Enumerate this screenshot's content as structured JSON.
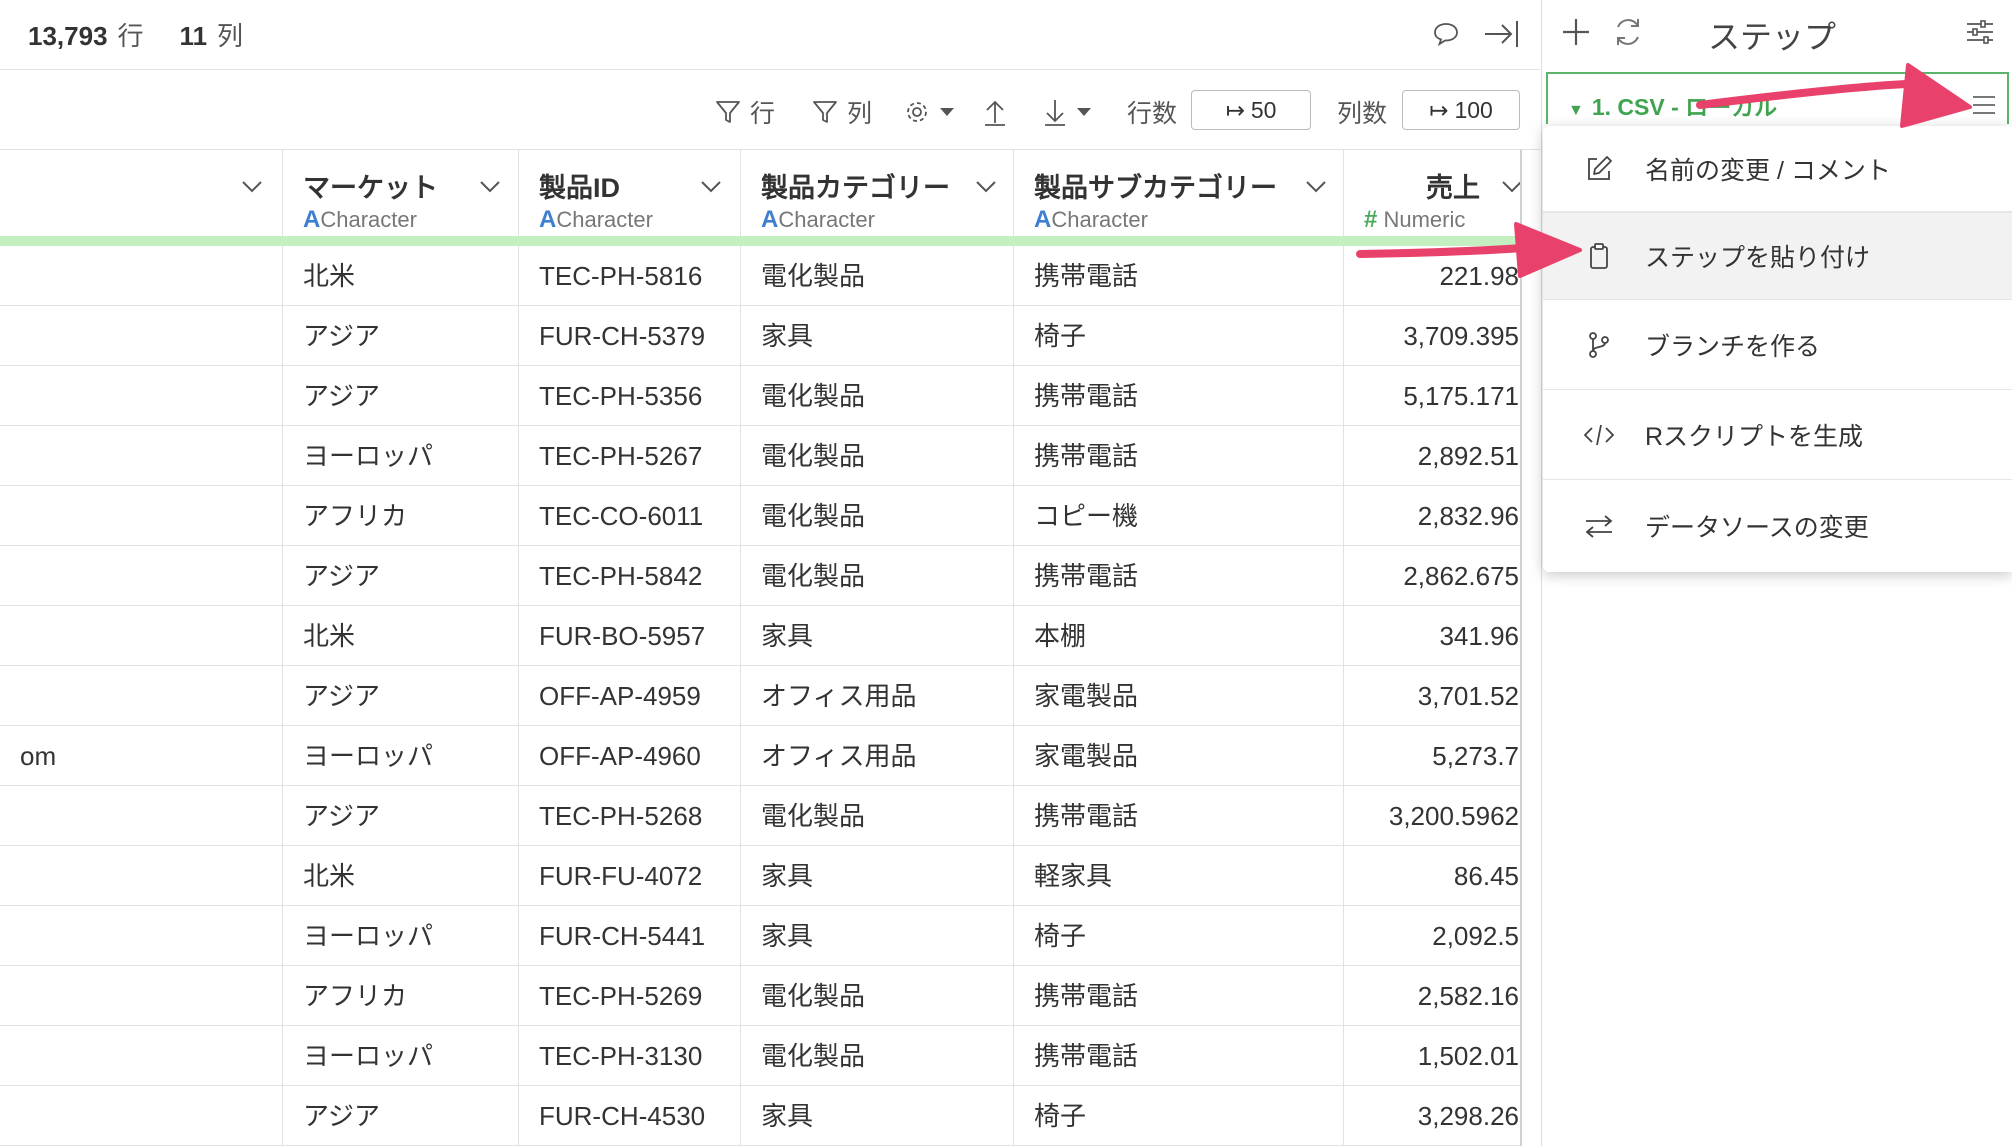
{
  "topbar": {
    "rows_count": "13,793",
    "rows_unit": "行",
    "cols_count": "11",
    "cols_unit": "列",
    "icons": [
      "comment-icon",
      "collapse-right-icon"
    ]
  },
  "toolbar": {
    "filter_rows": "行",
    "filter_cols": "列",
    "row_count_label": "行数",
    "row_count_value": "50",
    "col_count_label": "列数",
    "col_count_value": "100"
  },
  "columns": [
    {
      "name": "",
      "type": ""
    },
    {
      "name": "マーケット",
      "type": "Character",
      "type_symbol": "A"
    },
    {
      "name": "製品ID",
      "type": "Character",
      "type_symbol": "A"
    },
    {
      "name": "製品カテゴリー",
      "type": "Character",
      "type_symbol": "A"
    },
    {
      "name": "製品サブカテゴリー",
      "type": "Character",
      "type_symbol": "A"
    },
    {
      "name": "売上",
      "type": "Numeric",
      "type_symbol": "#"
    }
  ],
  "rows": [
    [
      "",
      "北米",
      "TEC-PH-5816",
      "電化製品",
      "携帯電話",
      "221.98"
    ],
    [
      "",
      "アジア",
      "FUR-CH-5379",
      "家具",
      "椅子",
      "3,709.395"
    ],
    [
      "",
      "アジア",
      "TEC-PH-5356",
      "電化製品",
      "携帯電話",
      "5,175.171"
    ],
    [
      "",
      "ヨーロッパ",
      "TEC-PH-5267",
      "電化製品",
      "携帯電話",
      "2,892.51"
    ],
    [
      "",
      "アフリカ",
      "TEC-CO-6011",
      "電化製品",
      "コピー機",
      "2,832.96"
    ],
    [
      "",
      "アジア",
      "TEC-PH-5842",
      "電化製品",
      "携帯電話",
      "2,862.675"
    ],
    [
      "",
      "北米",
      "FUR-BO-5957",
      "家具",
      "本棚",
      "341.96"
    ],
    [
      "",
      "アジア",
      "OFF-AP-4959",
      "オフィス用品",
      "家電製品",
      "3,701.52"
    ],
    [
      "om",
      "ヨーロッパ",
      "OFF-AP-4960",
      "オフィス用品",
      "家電製品",
      "5,273.7"
    ],
    [
      "",
      "アジア",
      "TEC-PH-5268",
      "電化製品",
      "携帯電話",
      "3,200.5962"
    ],
    [
      "",
      "北米",
      "FUR-FU-4072",
      "家具",
      "軽家具",
      "86.45"
    ],
    [
      "",
      "ヨーロッパ",
      "FUR-CH-5441",
      "家具",
      "椅子",
      "2,092.5"
    ],
    [
      "",
      "アフリカ",
      "TEC-PH-5269",
      "電化製品",
      "携帯電話",
      "2,582.16"
    ],
    [
      "",
      "ヨーロッパ",
      "TEC-PH-3130",
      "電化製品",
      "携帯電話",
      "1,502.01"
    ],
    [
      "",
      "アジア",
      "FUR-CH-4530",
      "家具",
      "椅子",
      "3,298.26"
    ]
  ],
  "steps": {
    "title": "ステップ",
    "step1_label": "1. CSV - ローカル"
  },
  "menu": {
    "items": [
      {
        "label": "名前の変更 / コメント",
        "icon": "edit-icon"
      },
      {
        "label": "ステップを貼り付け",
        "icon": "clipboard-icon"
      },
      {
        "label": "ブランチを作る",
        "icon": "branch-icon"
      },
      {
        "label": "Rスクリプトを生成",
        "icon": "code-icon"
      },
      {
        "label": "データソースの変更",
        "icon": "swap-icon"
      }
    ]
  },
  "colors": {
    "accent_green": "#3fa34f",
    "header_highlight": "#c4efc0",
    "arrow_pink": "#e8416b",
    "type_character": "#3f7fd0",
    "type_numeric": "#4caa5d"
  }
}
